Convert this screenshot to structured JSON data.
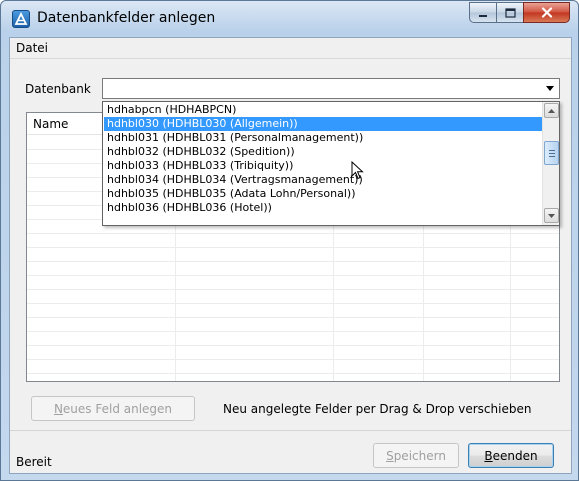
{
  "window": {
    "title": "Datenbankfelder anlegen"
  },
  "menu": {
    "items": [
      "Datei"
    ]
  },
  "database": {
    "label": "Datenbank",
    "value": ""
  },
  "grid": {
    "columns": [
      "Name"
    ]
  },
  "dropdown": {
    "selected_index": 1,
    "items": [
      "hdhabpcn (HDHABPCN)",
      "hdhbl030 (HDHBL030 (Allgemein))",
      "hdhbl031 (HDHBL031 (Personalmanagement))",
      "hdhbl032 (HDHBL032 (Spedition))",
      "hdhbl033 (HDHBL033 (Tribiquity))",
      "hdhbl034 (HDHBL034 (Vertragsmanagement))",
      "hdhbl035 (HDHBL035 (Adata Lohn/Personal))",
      "hdhbl036 (HDHBL036 (Hotel))"
    ]
  },
  "actions": {
    "new_field_prefix": "",
    "new_field_accel": "N",
    "new_field_rest": "eues Feld anlegen",
    "hint": "Neu angelegte Felder per Drag & Drop verschieben",
    "save_accel": "S",
    "save_rest": "peichern",
    "close_accel": "B",
    "close_rest": "eenden"
  },
  "status": {
    "text": "Bereit"
  },
  "colors": {
    "selection": "#3399ff",
    "window_frame": "#b9d1ea",
    "close_button": "#c13520"
  },
  "icons": {
    "app": "app-logo-icon",
    "minimize": "minimize-icon",
    "maximize": "maximize-icon",
    "close": "close-icon",
    "combo_arrow": "chevron-down-icon",
    "cursor": "mouse-pointer-icon"
  }
}
